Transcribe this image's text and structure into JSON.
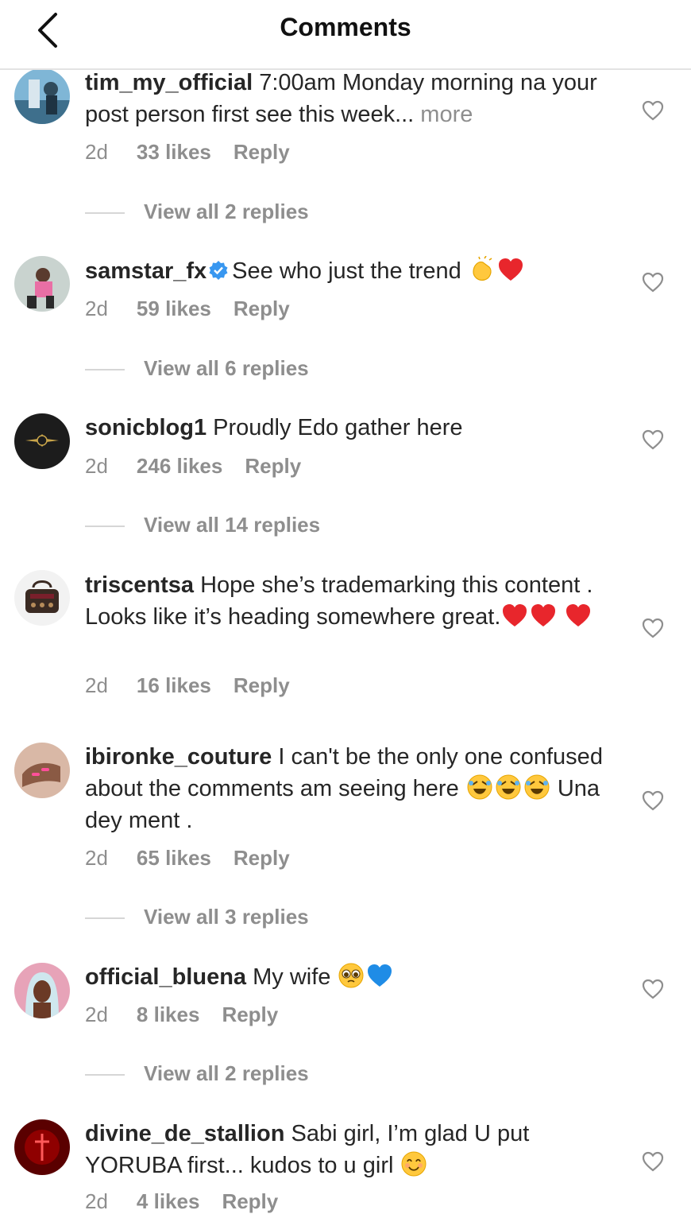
{
  "header": {
    "title": "Comments"
  },
  "comments": [
    {
      "username": "tim_my_official",
      "text": " 7:00am Monday morning na your post person first see this week...",
      "more": " more",
      "time": "2d",
      "likes": "33 likes",
      "reply": "Reply",
      "view_replies": "View all 2 replies"
    },
    {
      "username": "samstar_fx",
      "verified": true,
      "text": "See who just the trend ",
      "emojis": [
        "clapping-hands",
        "red-heart"
      ],
      "time": "2d",
      "likes": "59 likes",
      "reply": "Reply",
      "view_replies": "View all 6 replies"
    },
    {
      "username": "sonicblog1",
      "text": " Proudly Edo gather here",
      "time": "2d",
      "likes": "246 likes",
      "reply": "Reply",
      "view_replies": "View all 14 replies"
    },
    {
      "username": "triscentsa",
      "text": " Hope she’s trademarking this content . Looks like it’s heading somewhere great.",
      "emojis": [
        "red-heart",
        "red-heart",
        "red-heart"
      ],
      "time": "2d",
      "likes": "16 likes",
      "reply": "Reply"
    },
    {
      "username": "ibironke_couture",
      "text": " I can't be the only one confused about the comments am seeing here ",
      "emojis": [
        "rolling-laughing",
        "rolling-laughing",
        "rolling-laughing"
      ],
      "text_after": " Una dey ment .",
      "time": "2d",
      "likes": "65 likes",
      "reply": "Reply",
      "view_replies": "View all 3 replies"
    },
    {
      "username": "official_bluena",
      "text": " My wife ",
      "emojis": [
        "pleading-face",
        "blue-heart"
      ],
      "time": "2d",
      "likes": "8 likes",
      "reply": "Reply",
      "view_replies": "View all 2 replies"
    },
    {
      "username": "divine_de_stallion",
      "text": " Sabi girl, I’m glad U put YORUBA first... kudos to u girl ",
      "emojis": [
        "smiling-face"
      ],
      "time": "2d",
      "likes": "4 likes",
      "reply": "Reply"
    }
  ]
}
